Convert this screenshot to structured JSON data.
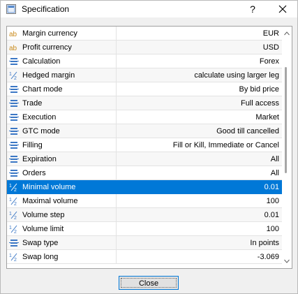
{
  "window": {
    "title": "Specification",
    "help_label": "?",
    "close_glyph": "✕"
  },
  "rows": [
    {
      "icon": "text-icon",
      "name": "Margin currency",
      "value": "EUR"
    },
    {
      "icon": "text-icon",
      "name": "Profit currency",
      "value": "USD"
    },
    {
      "icon": "list-icon",
      "name": "Calculation",
      "value": "Forex"
    },
    {
      "icon": "number-icon",
      "name": "Hedged margin",
      "value": "calculate using larger leg"
    },
    {
      "icon": "list-icon",
      "name": "Chart mode",
      "value": "By bid price"
    },
    {
      "icon": "list-icon",
      "name": "Trade",
      "value": "Full access"
    },
    {
      "icon": "list-icon",
      "name": "Execution",
      "value": "Market"
    },
    {
      "icon": "list-icon",
      "name": "GTC mode",
      "value": "Good till cancelled"
    },
    {
      "icon": "list-icon",
      "name": "Filling",
      "value": "Fill or Kill, Immediate or Cancel"
    },
    {
      "icon": "list-icon",
      "name": "Expiration",
      "value": "All"
    },
    {
      "icon": "list-icon",
      "name": "Orders",
      "value": "All"
    },
    {
      "icon": "number-icon",
      "name": "Minimal volume",
      "value": "0.01",
      "selected": true
    },
    {
      "icon": "number-icon",
      "name": "Maximal volume",
      "value": "100"
    },
    {
      "icon": "number-icon",
      "name": "Volume step",
      "value": "0.01"
    },
    {
      "icon": "number-icon",
      "name": "Volume limit",
      "value": "100"
    },
    {
      "icon": "list-icon",
      "name": "Swap type",
      "value": "In points"
    },
    {
      "icon": "number-icon",
      "name": "Swap long",
      "value": "-3.069"
    }
  ],
  "footer": {
    "close_label": "Close"
  }
}
